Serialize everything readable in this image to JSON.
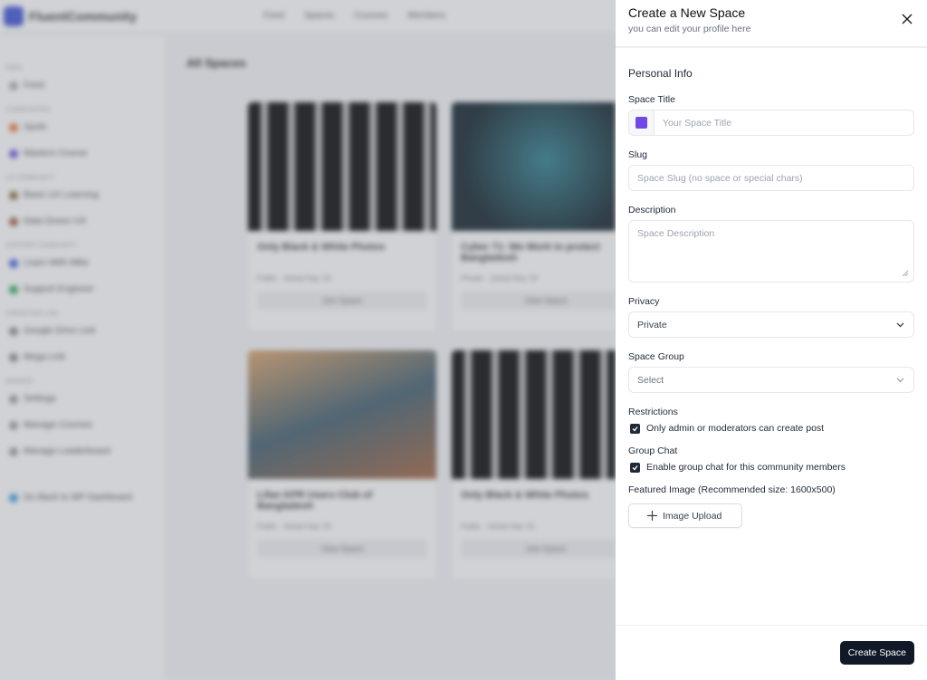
{
  "background": {
    "brand": "FluentCommunity",
    "topnav": [
      "Feed",
      "Spaces",
      "Courses",
      "Members"
    ],
    "page_title": "All Spaces",
    "sidebar": [
      {
        "section": "FEED",
        "items": [
          "Feed"
        ]
      },
      {
        "section": "COMMUNITIES",
        "items": [
          "Xpolo",
          "Masters Course"
        ]
      },
      {
        "section": "UX COMMUNITY",
        "items": [
          "Basic UX Learning",
          "Data Driven UX"
        ]
      },
      {
        "section": "SUPPORT COMMUNITY",
        "items": [
          "Learn With Mike",
          "Support Engineer"
        ]
      },
      {
        "section": "DOWNLOAD LINK",
        "items": [
          "Google Drive Link",
          "Mega Link"
        ]
      },
      {
        "section": "MANAGE",
        "items": [
          "Settings",
          "Manage Courses",
          "Manage Leaderboard"
        ]
      }
    ],
    "go_back": "Go Back to WP Dashboard",
    "cards": [
      {
        "title": "Only Black & White Photos",
        "meta": "Public · Joined Sep '24",
        "button": "Join Space"
      },
      {
        "title": "Cyber 71: We Work to protect Bangladesh",
        "meta": "Private · Joined Sep '24",
        "button": "View Space"
      },
      {
        "title": "Lifan KPR Users Club of Bangladesh",
        "meta": "Public · Joined Sep '24",
        "button": "View Space"
      },
      {
        "title": "Only Black & White Photos",
        "meta": "Public · Joined Sep '24",
        "button": "Join Space"
      }
    ]
  },
  "panel": {
    "title": "Create a New Space",
    "subtitle": "you can edit your profile here",
    "section": "Personal Info",
    "space_title": {
      "label": "Space Title",
      "placeholder": "Your Space Title",
      "color": "#7048e8"
    },
    "slug": {
      "label": "Slug",
      "placeholder": "Space Slug (no space or special chars)"
    },
    "description": {
      "label": "Description",
      "placeholder": "Space Description"
    },
    "privacy": {
      "label": "Privacy",
      "value": "Private"
    },
    "space_group": {
      "label": "Space Group",
      "value": "Select"
    },
    "restrictions": {
      "label": "Restrictions",
      "option": "Only admin or moderators can create post",
      "checked": true
    },
    "group_chat": {
      "label": "Group Chat",
      "option": "Enable group chat for this community members",
      "checked": true
    },
    "featured_image": {
      "label": "Featured Image (Recommended size: 1600x500)",
      "button": "Image Upload"
    },
    "submit": "Create Space"
  }
}
